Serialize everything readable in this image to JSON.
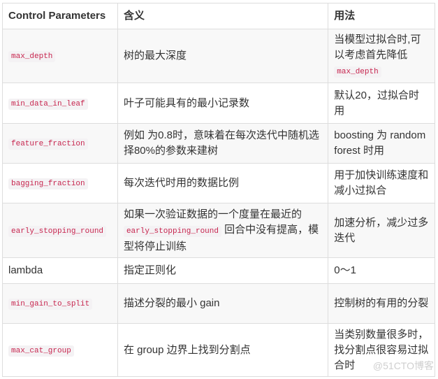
{
  "table": {
    "headers": [
      "Control Parameters",
      "含义",
      "用法"
    ],
    "rows": [
      {
        "param": "max_depth",
        "meaning": "树的最大深度",
        "usage_pre": "当模型过拟合时,可以考虑首先降低",
        "usage_code": "max_depth",
        "h": 77
      },
      {
        "param": "min_data_in_leaf",
        "meaning": "叶子可能具有的最小记录数",
        "usage_pre": "默认20，过拟合时用",
        "usage_code": "",
        "h": 58
      },
      {
        "param": "feature_fraction",
        "meaning": "例如 为0.8时，意味着在每次迭代中随机选择80%的参数来建树",
        "usage_pre": "boosting 为 random forest 时用",
        "usage_code": "",
        "h": 57
      },
      {
        "param": "bagging_fraction",
        "meaning": "每次迭代时用的数据比例",
        "usage_pre": "用于加快训练速度和减小过拟合",
        "usage_code": "",
        "h": 57
      },
      {
        "param": "early_stopping_round",
        "meaning_pre": "如果一次验证数据的一个度量在最近的",
        "meaning_code": "early_stopping_round",
        "meaning_post": "回合中没有提高，模型将停止训练",
        "usage_pre": "加速分析，减少过多迭代",
        "usage_code": "",
        "h": 78
      },
      {
        "param": "lambda",
        "param_plain": true,
        "meaning": "指定正则化",
        "usage_pre": "0～1",
        "usage_code": "",
        "h": 37
      },
      {
        "param": "min_gain_to_split",
        "meaning": "描述分裂的最小 gain",
        "usage_pre": "控制树的有用的分裂",
        "usage_code": "",
        "h": 57
      },
      {
        "param": "max_cat_group",
        "meaning": "在 group 边界上找到分割点",
        "usage_pre": "当类别数量很多时，找分割点很容易过拟合时",
        "usage_code": "",
        "h": 76
      }
    ]
  },
  "watermark": "@51CTO博客"
}
